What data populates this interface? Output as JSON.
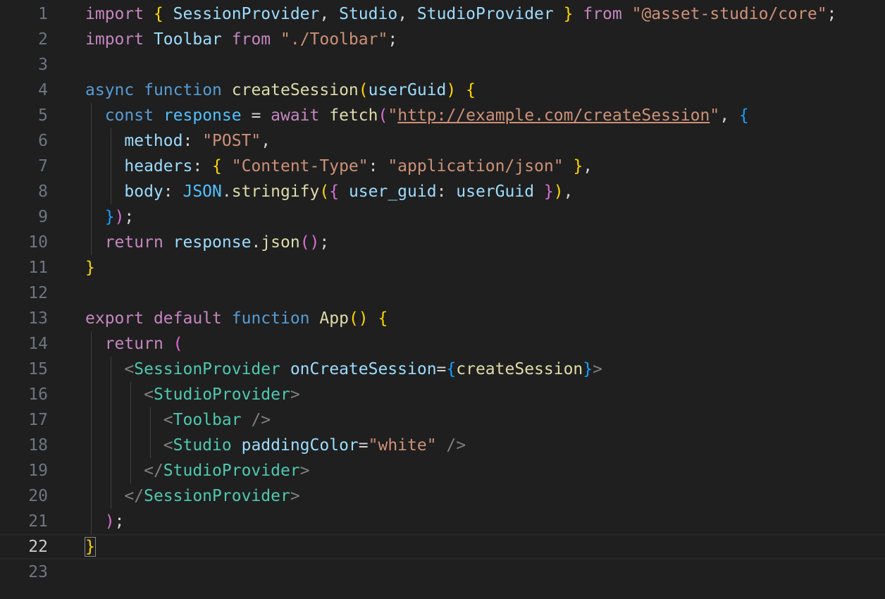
{
  "editor": {
    "language": "javascript-react",
    "current_line": 22,
    "line_numbers": [
      "1",
      "2",
      "3",
      "4",
      "5",
      "6",
      "7",
      "8",
      "9",
      "10",
      "11",
      "12",
      "13",
      "14",
      "15",
      "16",
      "17",
      "18",
      "19",
      "20",
      "21",
      "22",
      "23"
    ]
  },
  "lines": [
    [
      [
        "kw",
        "import"
      ],
      [
        "p",
        " "
      ],
      [
        "b1",
        "{"
      ],
      [
        "p",
        " "
      ],
      [
        "vr",
        "SessionProvider"
      ],
      [
        "p",
        ", "
      ],
      [
        "vr",
        "Studio"
      ],
      [
        "p",
        ", "
      ],
      [
        "vr",
        "StudioProvider"
      ],
      [
        "p",
        " "
      ],
      [
        "b1",
        "}"
      ],
      [
        "p",
        " "
      ],
      [
        "kw",
        "from"
      ],
      [
        "p",
        " "
      ],
      [
        "s",
        "\"@asset-studio/core\""
      ],
      [
        "p",
        ";"
      ]
    ],
    [
      [
        "kw",
        "import"
      ],
      [
        "p",
        " "
      ],
      [
        "vr",
        "Toolbar"
      ],
      [
        "p",
        " "
      ],
      [
        "kw",
        "from"
      ],
      [
        "p",
        " "
      ],
      [
        "s",
        "\"./Toolbar\""
      ],
      [
        "p",
        ";"
      ]
    ],
    [],
    [
      [
        "st",
        "async"
      ],
      [
        "p",
        " "
      ],
      [
        "st",
        "function"
      ],
      [
        "p",
        " "
      ],
      [
        "fn",
        "createSession"
      ],
      [
        "b1",
        "("
      ],
      [
        "vr",
        "userGuid"
      ],
      [
        "b1",
        ")"
      ],
      [
        "p",
        " "
      ],
      [
        "b1",
        "{"
      ]
    ],
    [
      [
        "p",
        "  "
      ],
      [
        "st",
        "const"
      ],
      [
        "p",
        " "
      ],
      [
        "cn",
        "response"
      ],
      [
        "p",
        " = "
      ],
      [
        "kw",
        "await"
      ],
      [
        "p",
        " "
      ],
      [
        "fn",
        "fetch"
      ],
      [
        "b2",
        "("
      ],
      [
        "s",
        "\""
      ],
      [
        "s url",
        "http://example.com/createSession"
      ],
      [
        "s",
        "\""
      ],
      [
        "p",
        ", "
      ],
      [
        "b3",
        "{"
      ]
    ],
    [
      [
        "p",
        "    "
      ],
      [
        "vr",
        "method"
      ],
      [
        "p",
        ": "
      ],
      [
        "s",
        "\"POST\""
      ],
      [
        "p",
        ","
      ]
    ],
    [
      [
        "p",
        "    "
      ],
      [
        "vr",
        "headers"
      ],
      [
        "p",
        ": "
      ],
      [
        "b1",
        "{"
      ],
      [
        "p",
        " "
      ],
      [
        "s",
        "\"Content-Type\""
      ],
      [
        "p",
        ": "
      ],
      [
        "s",
        "\"application/json\""
      ],
      [
        "p",
        " "
      ],
      [
        "b1",
        "}"
      ],
      [
        "p",
        ","
      ]
    ],
    [
      [
        "p",
        "    "
      ],
      [
        "vr",
        "body"
      ],
      [
        "p",
        ": "
      ],
      [
        "cn",
        "JSON"
      ],
      [
        "p",
        "."
      ],
      [
        "fn",
        "stringify"
      ],
      [
        "b1",
        "("
      ],
      [
        "b2",
        "{"
      ],
      [
        "p",
        " "
      ],
      [
        "vr",
        "user_guid"
      ],
      [
        "p",
        ": "
      ],
      [
        "vr",
        "userGuid"
      ],
      [
        "p",
        " "
      ],
      [
        "b2",
        "}"
      ],
      [
        "b1",
        ")"
      ],
      [
        "p",
        ","
      ]
    ],
    [
      [
        "p",
        "  "
      ],
      [
        "b3",
        "}"
      ],
      [
        "b2",
        ")"
      ],
      [
        "p",
        ";"
      ]
    ],
    [
      [
        "p",
        "  "
      ],
      [
        "kw",
        "return"
      ],
      [
        "p",
        " "
      ],
      [
        "vr",
        "response"
      ],
      [
        "p",
        "."
      ],
      [
        "fn",
        "json"
      ],
      [
        "b2",
        "("
      ],
      [
        "b2",
        ")"
      ],
      [
        "p",
        ";"
      ]
    ],
    [
      [
        "b1",
        "}"
      ]
    ],
    [],
    [
      [
        "kw",
        "export"
      ],
      [
        "p",
        " "
      ],
      [
        "kw",
        "default"
      ],
      [
        "p",
        " "
      ],
      [
        "st",
        "function"
      ],
      [
        "p",
        " "
      ],
      [
        "fn",
        "App"
      ],
      [
        "b1",
        "("
      ],
      [
        "b1",
        ")"
      ],
      [
        "p",
        " "
      ],
      [
        "b1",
        "{"
      ]
    ],
    [
      [
        "p",
        "  "
      ],
      [
        "kw",
        "return"
      ],
      [
        "p",
        " "
      ],
      [
        "b2",
        "("
      ]
    ],
    [
      [
        "p",
        "    "
      ],
      [
        "tg",
        "<"
      ],
      [
        "cl",
        "SessionProvider"
      ],
      [
        "p",
        " "
      ],
      [
        "vr",
        "onCreateSession"
      ],
      [
        "p",
        "="
      ],
      [
        "b3",
        "{"
      ],
      [
        "fn",
        "createSession"
      ],
      [
        "b3",
        "}"
      ],
      [
        "tg",
        ">"
      ]
    ],
    [
      [
        "p",
        "      "
      ],
      [
        "tg",
        "<"
      ],
      [
        "cl",
        "StudioProvider"
      ],
      [
        "tg",
        ">"
      ]
    ],
    [
      [
        "p",
        "        "
      ],
      [
        "tg",
        "<"
      ],
      [
        "cl",
        "Toolbar"
      ],
      [
        "p",
        " "
      ],
      [
        "tg",
        "/>"
      ]
    ],
    [
      [
        "p",
        "        "
      ],
      [
        "tg",
        "<"
      ],
      [
        "cl",
        "Studio"
      ],
      [
        "p",
        " "
      ],
      [
        "vr",
        "paddingColor"
      ],
      [
        "p",
        "="
      ],
      [
        "s",
        "\"white\""
      ],
      [
        "p",
        " "
      ],
      [
        "tg",
        "/>"
      ]
    ],
    [
      [
        "p",
        "      "
      ],
      [
        "tg",
        "</"
      ],
      [
        "cl",
        "StudioProvider"
      ],
      [
        "tg",
        ">"
      ]
    ],
    [
      [
        "p",
        "    "
      ],
      [
        "tg",
        "</"
      ],
      [
        "cl",
        "SessionProvider"
      ],
      [
        "tg",
        ">"
      ]
    ],
    [
      [
        "p",
        "  "
      ],
      [
        "b2",
        ")"
      ],
      [
        "p",
        ";"
      ]
    ],
    [
      [
        "b1",
        "}"
      ]
    ],
    []
  ]
}
